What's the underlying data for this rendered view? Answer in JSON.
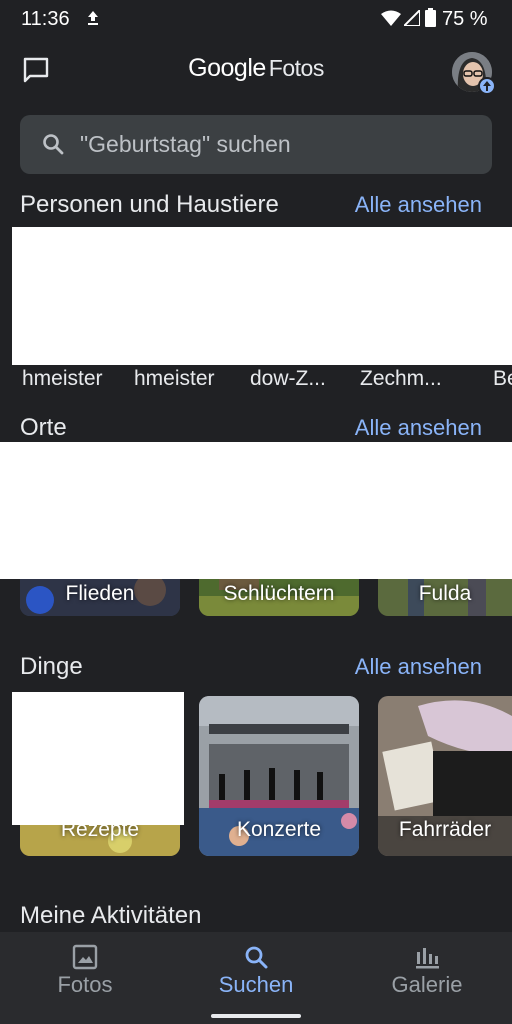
{
  "status_bar": {
    "time": "11:36",
    "battery": "75 %",
    "icons": [
      "upload-icon",
      "wifi-icon",
      "signal-icon",
      "battery-icon"
    ]
  },
  "header": {
    "logo_google": "Google",
    "logo_product": "Fotos"
  },
  "search": {
    "placeholder": "\"Geburtstag\" suchen"
  },
  "sections": {
    "people": {
      "title": "Personen und Haustiere",
      "see_all": "Alle ansehen",
      "items": [
        "hmeister",
        "hmeister",
        "dow-Z...",
        "Zechm...",
        "Be"
      ]
    },
    "places": {
      "title": "Orte",
      "see_all": "Alle ansehen",
      "items": [
        "Flieden",
        "Schlüchtern",
        "Fulda"
      ]
    },
    "things": {
      "title": "Dinge",
      "see_all": "Alle ansehen",
      "items": [
        "Rezepte",
        "Konzerte",
        "Fahrräder"
      ]
    },
    "activities": {
      "title": "Meine Aktivitäten"
    }
  },
  "bottom_nav": {
    "items": [
      {
        "label": "Fotos",
        "icon": "image-icon",
        "active": false
      },
      {
        "label": "Suchen",
        "icon": "search-icon",
        "active": true
      },
      {
        "label": "Galerie",
        "icon": "library-icon",
        "active": false
      }
    ]
  },
  "colors": {
    "background": "#202124",
    "accent": "#8ab4f8",
    "search_field": "#3c4043",
    "nav_background": "#2a2b2e"
  }
}
